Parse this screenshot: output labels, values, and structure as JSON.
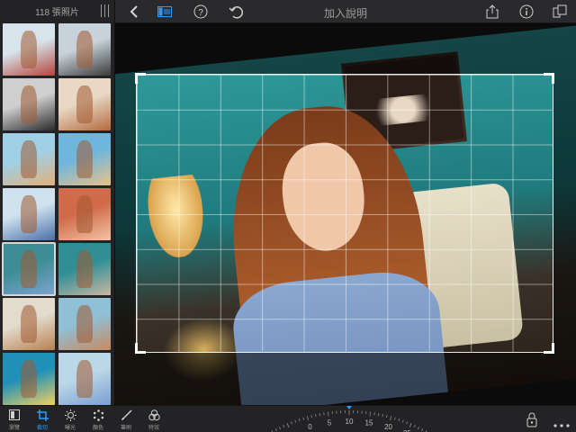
{
  "sidebar": {
    "photo_count": "118 張照片",
    "thumbnails": [
      {
        "colors": [
          "#d8e4ec",
          "#b4443a"
        ]
      },
      {
        "colors": [
          "#c8d2da",
          "#3a3a3a"
        ]
      },
      {
        "colors": [
          "#cfcfcf",
          "#2a2a2a"
        ]
      },
      {
        "colors": [
          "#e8d8c4",
          "#b46a3e"
        ]
      },
      {
        "colors": [
          "#9fd0e6",
          "#e2b07a"
        ]
      },
      {
        "colors": [
          "#6fb6dc",
          "#e8c28a"
        ]
      },
      {
        "colors": [
          "#cfe2ee",
          "#4a6fa8"
        ]
      },
      {
        "colors": [
          "#d06a4a",
          "#f1c5a5"
        ]
      },
      {
        "colors": [
          "#3d8e94",
          "#7fa2d0"
        ],
        "selected": true
      },
      {
        "colors": [
          "#2f8e96",
          "#c9b7a2"
        ]
      },
      {
        "colors": [
          "#e3dccd",
          "#b88050"
        ]
      },
      {
        "colors": [
          "#8fc0d8",
          "#c88a60"
        ]
      },
      {
        "colors": [
          "#1f90b8",
          "#f0d060"
        ]
      },
      {
        "colors": [
          "#bcd8e8",
          "#7a9ed0"
        ]
      }
    ]
  },
  "toolbar": {
    "title": "加入說明",
    "icons": [
      "back-icon",
      "sidebar-toggle-icon",
      "help-icon",
      "undo-icon",
      "share-icon",
      "info-icon",
      "pages-icon"
    ]
  },
  "bottom_tools": [
    {
      "id": "browse",
      "label": "瀏覽",
      "icon": "browse-icon",
      "active": false
    },
    {
      "id": "crop",
      "label": "裁切",
      "icon": "crop-icon",
      "active": true
    },
    {
      "id": "exposure",
      "label": "曝光",
      "icon": "exposure-icon",
      "active": false
    },
    {
      "id": "color",
      "label": "顏色",
      "icon": "color-icon",
      "active": false
    },
    {
      "id": "brush",
      "label": "筆刷",
      "icon": "brush-icon",
      "active": false
    },
    {
      "id": "effects",
      "label": "特效",
      "icon": "effects-icon",
      "active": false
    }
  ],
  "rotation_dial": {
    "labels": [
      "0",
      "5",
      "10",
      "15",
      "20",
      "25"
    ],
    "current_value": 10
  },
  "right_tools": {
    "lock_icon": "lock-icon",
    "more_icon": "more-icon"
  },
  "colors": {
    "accent": "#2f9bff",
    "toolbar_bg": "#2a2a2c",
    "sidebar_bg": "#232325"
  }
}
